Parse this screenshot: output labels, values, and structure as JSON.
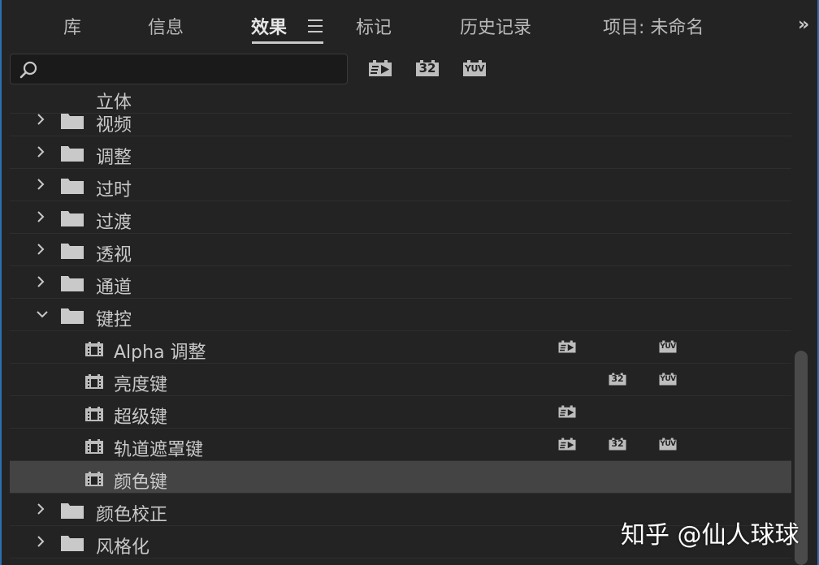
{
  "tabs": [
    {
      "label": "库"
    },
    {
      "label": "信息"
    },
    {
      "label": "效果"
    },
    {
      "label": "标记"
    },
    {
      "label": "历史记录"
    },
    {
      "label": "项目: 未命名"
    }
  ],
  "overflow_label": "»",
  "search": {
    "value": "",
    "placeholder": ""
  },
  "toolbar_badges": [
    {
      "icon": "accelerated-effects-icon",
      "text": ""
    },
    {
      "icon": "32-bit-color-icon",
      "text": "32"
    },
    {
      "icon": "yuv-effects-icon",
      "text": "YUV"
    }
  ],
  "tree": {
    "partial_top_label": "立体",
    "folders_top": [
      {
        "label": "视频"
      },
      {
        "label": "调整"
      },
      {
        "label": "过时"
      },
      {
        "label": "过渡"
      },
      {
        "label": "透视"
      },
      {
        "label": "通道"
      }
    ],
    "expanded_folder": {
      "label": "键控"
    },
    "effects": [
      {
        "label": "Alpha 调整",
        "accel": true,
        "b32": false,
        "yuv": true,
        "selected": false
      },
      {
        "label": "亮度键",
        "accel": false,
        "b32": true,
        "yuv": true,
        "selected": false
      },
      {
        "label": "超级键",
        "accel": true,
        "b32": false,
        "yuv": false,
        "selected": false
      },
      {
        "label": "轨道遮罩键",
        "accel": true,
        "b32": true,
        "yuv": true,
        "selected": false
      },
      {
        "label": "颜色键",
        "accel": false,
        "b32": false,
        "yuv": false,
        "selected": true
      }
    ],
    "folders_bottom": [
      {
        "label": "颜色校正"
      },
      {
        "label": "风格化"
      }
    ]
  },
  "badge_texts": {
    "b32": "32",
    "yuv": "YUV"
  },
  "watermark": "知乎 @仙人球球",
  "colors": {
    "background": "#232323",
    "selected_row": "#444444",
    "accent_frame": "#2d6fb3",
    "badge": "#bdbdbd"
  }
}
